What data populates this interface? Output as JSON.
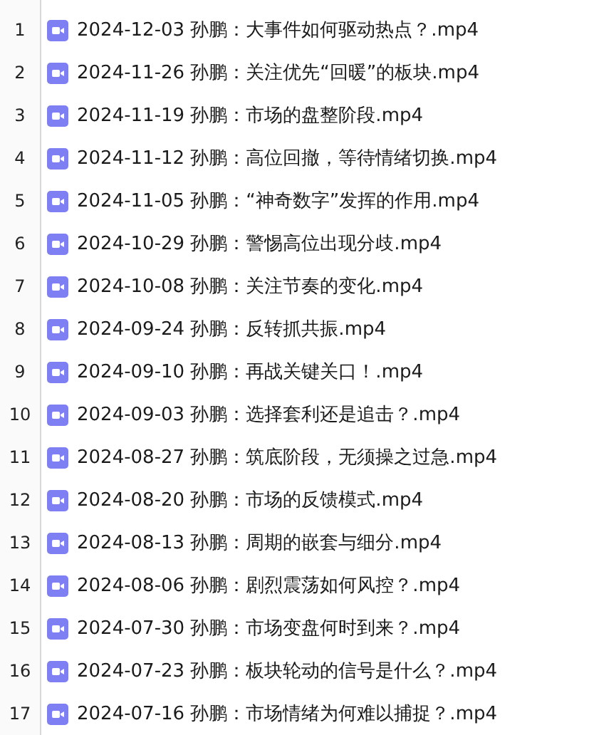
{
  "files": [
    {
      "number": "1",
      "name": "2024-12-03 孙鹏：大事件如何驱动热点？.mp4"
    },
    {
      "number": "2",
      "name": "2024-11-26 孙鹏：关注优先“回暖”的板块.mp4"
    },
    {
      "number": "3",
      "name": "2024-11-19 孙鹏：市场的盘整阶段.mp4"
    },
    {
      "number": "4",
      "name": "2024-11-12 孙鹏：高位回撤，等待情绪切换.mp4"
    },
    {
      "number": "5",
      "name": "2024-11-05 孙鹏：“神奇数字”发挥的作用.mp4"
    },
    {
      "number": "6",
      "name": "2024-10-29 孙鹏：警惕高位出现分歧.mp4"
    },
    {
      "number": "7",
      "name": "2024-10-08 孙鹏：关注节奏的变化.mp4"
    },
    {
      "number": "8",
      "name": "2024-09-24 孙鹏：反转抓共振.mp4"
    },
    {
      "number": "9",
      "name": "2024-09-10 孙鹏：再战关键关口！.mp4"
    },
    {
      "number": "10",
      "name": "2024-09-03 孙鹏：选择套利还是追击？.mp4"
    },
    {
      "number": "11",
      "name": "2024-08-27 孙鹏：筑底阶段，无须操之过急.mp4"
    },
    {
      "number": "12",
      "name": "2024-08-20 孙鹏：市场的反馈模式.mp4"
    },
    {
      "number": "13",
      "name": "2024-08-13 孙鹏：周期的嵌套与细分.mp4"
    },
    {
      "number": "14",
      "name": "2024-08-06 孙鹏：剧烈震荡如何风控？.mp4"
    },
    {
      "number": "15",
      "name": "2024-07-30 孙鹏：市场变盘何时到来？.mp4"
    },
    {
      "number": "16",
      "name": "2024-07-23 孙鹏：板块轮动的信号是什么？.mp4"
    },
    {
      "number": "17",
      "name": "2024-07-16 孙鹏：市场情绪为何难以捕捉？.mp4"
    }
  ]
}
